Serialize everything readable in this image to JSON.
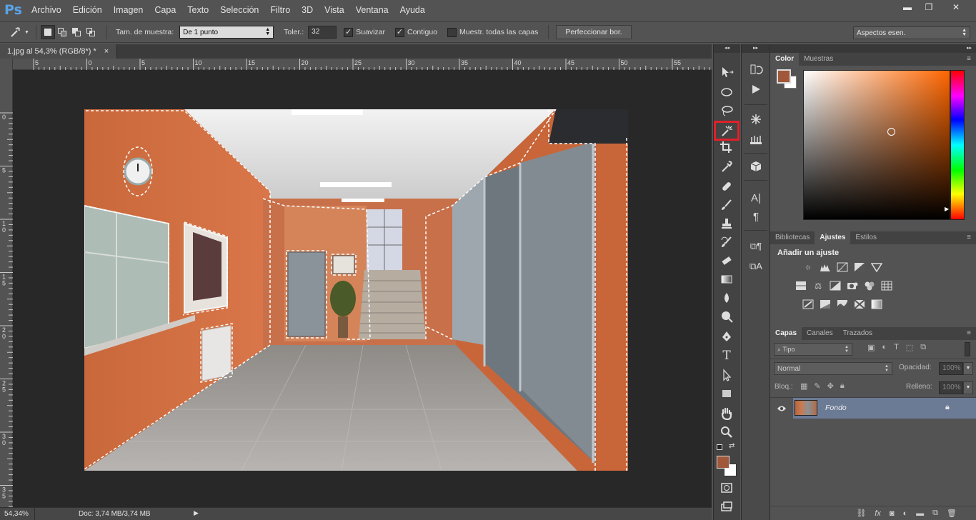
{
  "app": {
    "logo": "Ps"
  },
  "menu": [
    "Archivo",
    "Edición",
    "Imagen",
    "Capa",
    "Texto",
    "Selección",
    "Filtro",
    "3D",
    "Vista",
    "Ventana",
    "Ayuda"
  ],
  "window_buttons": {
    "minimize": "▬",
    "restore": "❐",
    "close": "✕"
  },
  "options": {
    "sample_label": "Tam. de muestra:",
    "sample_value": "De 1 punto",
    "tolerance_label": "Toler.:",
    "tolerance_value": "32",
    "antialias_label": "Suavizar",
    "contiguous_label": "Contiguo",
    "sample_all_label": "Muestr. todas las capas",
    "refine_button": "Perfeccionar bor.",
    "workspace": "Aspectos esen."
  },
  "document": {
    "tab_title": "1.jpg al 54,3% (RGB/8*) *",
    "tab_close": "×",
    "zoom": "54,34%",
    "doc_info": "Doc: 3,74 MB/3,74 MB"
  },
  "rulers": {
    "top": [
      "5",
      "0",
      "5",
      "10",
      "15",
      "20",
      "25",
      "30",
      "35",
      "40",
      "45",
      "50",
      "55"
    ],
    "left": [
      "0",
      "5",
      "1 0",
      "1 5",
      "2 0",
      "2 5",
      "3 0",
      "3 5"
    ]
  },
  "color_panel": {
    "tabs": [
      "Color",
      "Muestras"
    ],
    "foreground": "#a0573a",
    "background": "#ffffff",
    "hue_color": "#ff6600"
  },
  "adjust_panel": {
    "tabs": [
      "Bibliotecas",
      "Ajustes",
      "Estilos"
    ],
    "active_tab": "Ajustes",
    "heading": "Añadir un ajuste"
  },
  "layers_panel": {
    "tabs": [
      "Capas",
      "Canales",
      "Trazados"
    ],
    "filter_kind": "Tipo",
    "blend_mode": "Normal",
    "opacity_label": "Opacidad:",
    "opacity_value": "100%",
    "lock_label": "Bloq.:",
    "fill_label": "Relleno:",
    "fill_value": "100%",
    "layers": [
      {
        "name": "Fondo",
        "visible": true,
        "locked": true
      }
    ]
  },
  "highlight": {
    "tool": "magic-wand",
    "color": "#e0202a"
  }
}
